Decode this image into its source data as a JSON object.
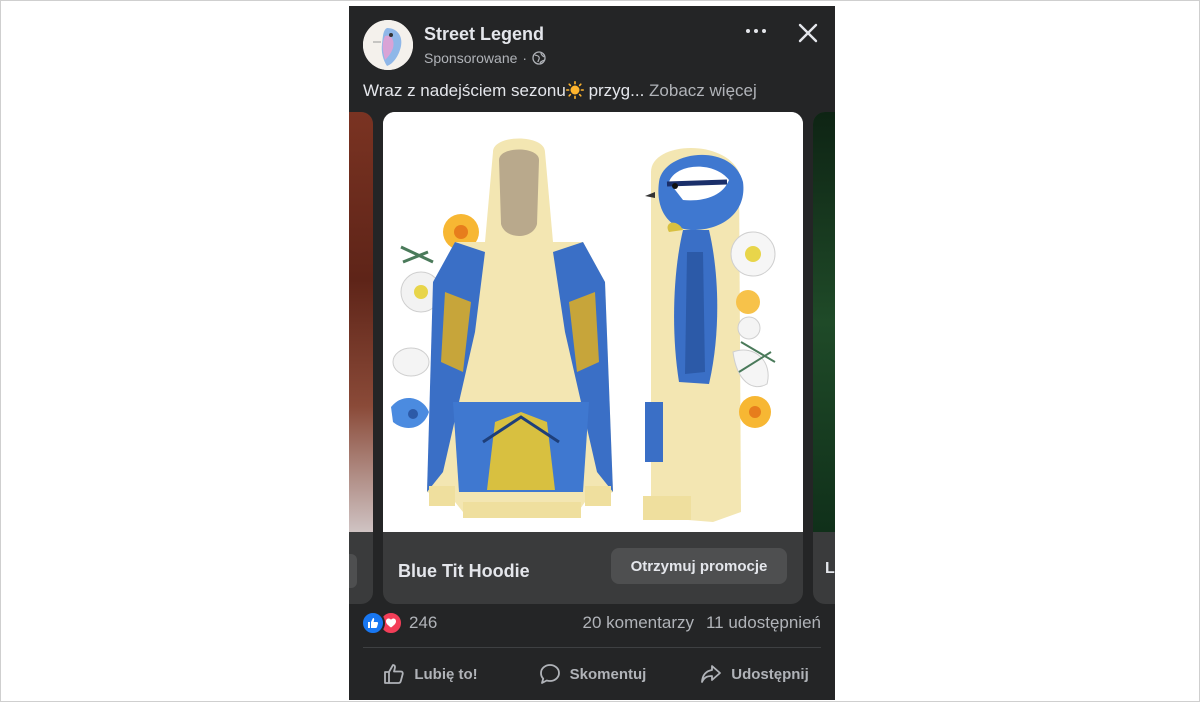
{
  "post": {
    "page_name": "Street Legend",
    "sponsored_label": "Sponsorowane",
    "separator": "·",
    "caption_text": "Wraz z nadejściem sezonu",
    "caption_emoji_icon": "sun-emoji",
    "caption_truncated": " przyg...",
    "see_more": "Zobacz więcej"
  },
  "carousel": {
    "current_card": {
      "title": "Blue Tit Hoodie",
      "cta_label": "Otrzymuj promocje"
    },
    "next_card_partial_title": "L"
  },
  "engagement": {
    "reactions_count": "246",
    "reaction_icons": [
      "like-reaction-icon",
      "love-reaction-icon"
    ],
    "comments": "20 komentarzy",
    "shares": "11 udostępnień"
  },
  "actions": {
    "like": "Lubię to!",
    "comment": "Skomentuj",
    "share": "Udostępnij"
  },
  "colors": {
    "post_bg": "#242526",
    "card_bg": "#3a3b3c",
    "text_primary": "#e4e6eb",
    "text_secondary": "#b0b3b8",
    "like_blue": "#1877f2",
    "love_red": "#f33e58",
    "hoodie_cream": "#f3e6b2"
  }
}
